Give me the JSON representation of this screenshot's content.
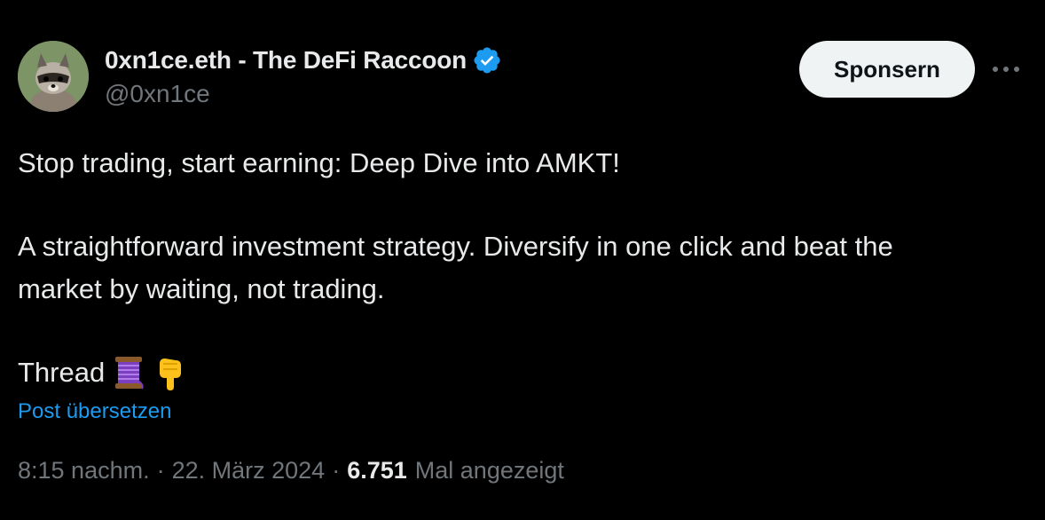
{
  "author": {
    "display_name": "0xn1ce.eth - The DeFi Raccoon",
    "handle": "@0xn1ce",
    "verified": true,
    "avatar_icon": "raccoon-avatar"
  },
  "actions": {
    "sponsor_label": "Sponsern",
    "more_icon": "more-horizontal-icon"
  },
  "tweet": {
    "line1": "Stop trading, start earning: Deep Dive into AMKT!",
    "line2": "A straightforward investment strategy. Diversify in one click and beat the",
    "line3": "market by waiting, not trading.",
    "thread_label": "Thread",
    "thread_emojis": [
      "spool-of-thread-icon",
      "pointing-down-icon"
    ],
    "translate_label": "Post übersetzen"
  },
  "meta": {
    "time": "8:15 nachm.",
    "separator": "·",
    "date": "22. März 2024",
    "views_count": "6.751",
    "views_label": "Mal angezeigt"
  },
  "colors": {
    "background": "#000000",
    "text": "#e7e9ea",
    "secondary": "#71767b",
    "link": "#1d9bf0",
    "verified": "#1d9bf0",
    "button_bg": "#eff3f4"
  }
}
